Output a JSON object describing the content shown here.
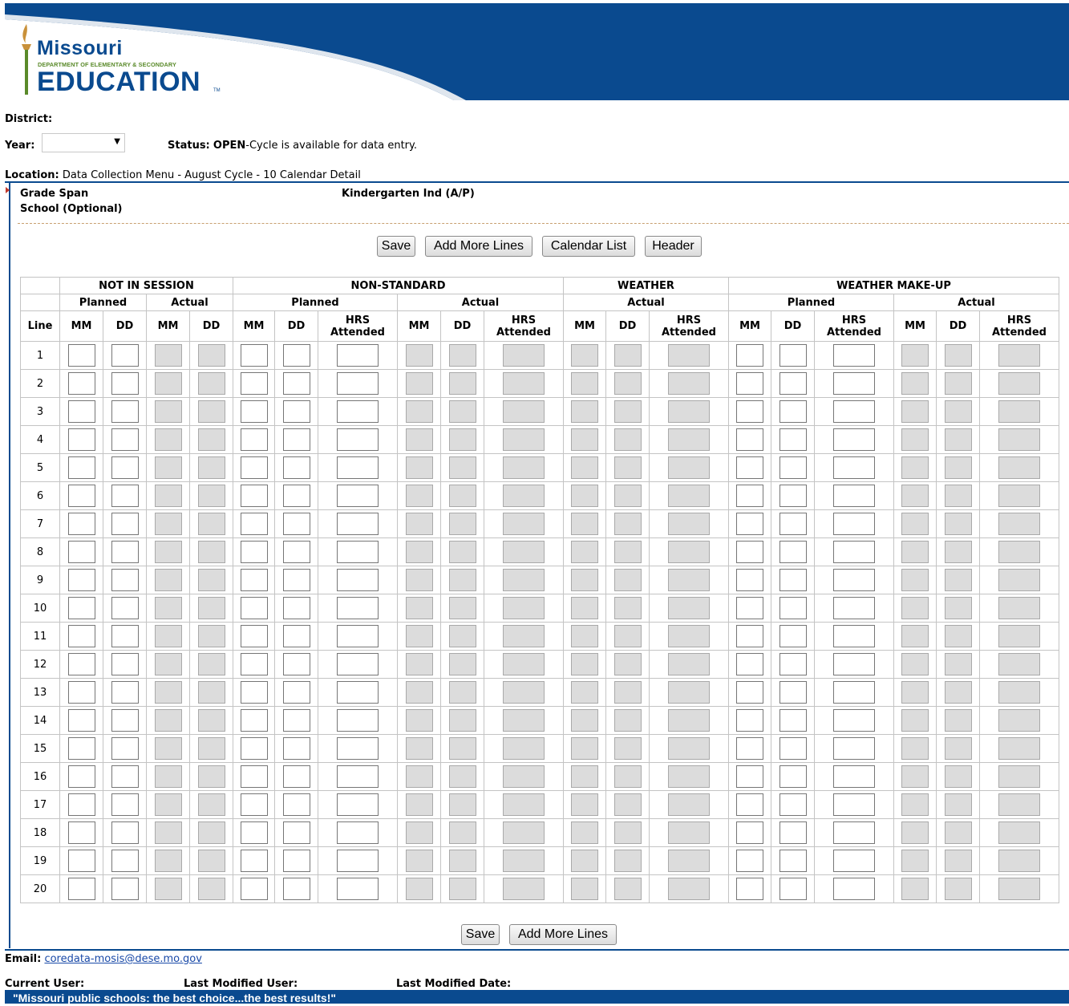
{
  "logo": {
    "line1": "Missouri",
    "line2": "DEPARTMENT OF ELEMENTARY & SECONDARY",
    "line3": "EDUCATION",
    "tm": "TM"
  },
  "header": {
    "district_label": "District:",
    "year_label": "Year:",
    "status_label": "Status:",
    "status_value": "OPEN",
    "status_text": "-Cycle is available for data entry.",
    "location_label": "Location:",
    "location_value": "Data Collection Menu - August Cycle - 10 Calendar Detail"
  },
  "section": {
    "grade_span_label": "Grade Span",
    "grade_span_value": "Kindergarten Ind (A/P)",
    "school_label": "School (Optional)"
  },
  "buttons": {
    "save": "Save",
    "add_more_lines": "Add More Lines",
    "calendar_list": "Calendar List",
    "header": "Header"
  },
  "table": {
    "groups": [
      "NOT IN SESSION",
      "NON-STANDARD",
      "WEATHER",
      "WEATHER MAKE-UP"
    ],
    "subgroups": [
      "Planned",
      "Actual"
    ],
    "columns": {
      "line": "Line",
      "mm": "MM",
      "dd": "DD",
      "hrs1": "HRS",
      "hrs2": "Attended"
    },
    "rows": [
      "1",
      "2",
      "3",
      "4",
      "5",
      "6",
      "7",
      "8",
      "9",
      "10",
      "11",
      "12",
      "13",
      "14",
      "15",
      "16",
      "17",
      "18",
      "19",
      "20"
    ]
  },
  "footer": {
    "email_label": "Email:",
    "email": "coredata-mosis@dese.mo.gov",
    "current_user_label": "Current User:",
    "last_modified_user_label": "Last Modified User:",
    "last_modified_date_label": "Last Modified Date:",
    "quote": "\"Missouri public schools: the best choice...the best results!\""
  }
}
